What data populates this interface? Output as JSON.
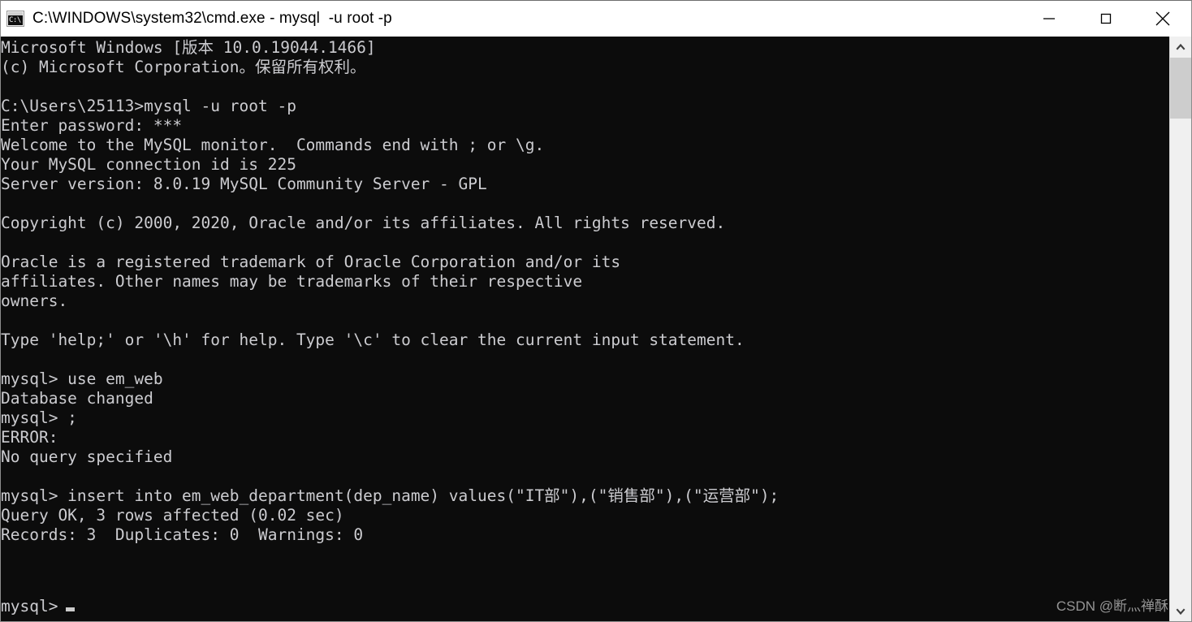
{
  "window": {
    "title": "C:\\WINDOWS\\system32\\cmd.exe - mysql  -u root -p",
    "icon_name": "cmd-console-icon",
    "icon_glyph": "C:\\",
    "background_color": "#0c0c0c",
    "titlebar_color": "#ffffff",
    "text_color": "#ccccd0"
  },
  "controls": {
    "minimize_label": "Minimize",
    "maximize_label": "Maximize",
    "close_label": "Close"
  },
  "terminal": {
    "content": "Microsoft Windows [版本 10.0.19044.1466]\n(c) Microsoft Corporation。保留所有权利。\n\nC:\\Users\\25113>mysql -u root -p\nEnter password: ***\nWelcome to the MySQL monitor.  Commands end with ; or \\g.\nYour MySQL connection id is 225\nServer version: 8.0.19 MySQL Community Server - GPL\n\nCopyright (c) 2000, 2020, Oracle and/or its affiliates. All rights reserved.\n\nOracle is a registered trademark of Oracle Corporation and/or its\naffiliates. Other names may be trademarks of their respective\nowners.\n\nType 'help;' or '\\h' for help. Type '\\c' to clear the current input statement.\n\nmysql> use em_web\nDatabase changed\nmysql> ;\nERROR:\nNo query specified\n\nmysql> insert into em_web_department(dep_name) values(\"IT部\"),(\"销售部\"),(\"运营部\");\nQuery OK, 3 rows affected (0.02 sec)\nRecords: 3  Duplicates: 0  Warnings: 0\n",
    "prompt": "mysql>",
    "lines": [
      "Microsoft Windows [版本 10.0.19044.1466]",
      "(c) Microsoft Corporation。保留所有权利。",
      "",
      "C:\\Users\\25113>mysql -u root -p",
      "Enter password: ***",
      "Welcome to the MySQL monitor.  Commands end with ; or \\g.",
      "Your MySQL connection id is 225",
      "Server version: 8.0.19 MySQL Community Server - GPL",
      "",
      "Copyright (c) 2000, 2020, Oracle and/or its affiliates. All rights reserved.",
      "",
      "Oracle is a registered trademark of Oracle Corporation and/or its",
      "affiliates. Other names may be trademarks of their respective",
      "owners.",
      "",
      "Type 'help;' or '\\h' for help. Type '\\c' to clear the current input statement.",
      "",
      "mysql> use em_web",
      "Database changed",
      "mysql> ;",
      "ERROR:",
      "No query specified",
      "",
      "mysql> insert into em_web_department(dep_name) values(\"IT部\"),(\"销售部\"),(\"运营部\");",
      "Query OK, 3 rows affected (0.02 sec)",
      "Records: 3  Duplicates: 0  Warnings: 0",
      ""
    ],
    "os_version": "10.0.19044.1466",
    "user_path": "C:\\Users\\25113",
    "command": "mysql -u root -p",
    "password_mask": "***",
    "connection_id": "225",
    "server_version": "8.0.19 MySQL Community Server - GPL",
    "database": "em_web",
    "table": "em_web_department",
    "column": "dep_name",
    "inserted_values": [
      "IT部",
      "销售部",
      "运营部"
    ],
    "rows_affected": "3",
    "duration": "0.02 sec",
    "records": "3",
    "duplicates": "0",
    "warnings": "0"
  },
  "watermark": {
    "text": "CSDN @断灬禅酥"
  },
  "scrollbar": {
    "up_arrow_name": "scroll-up-arrow",
    "down_arrow_name": "scroll-down-arrow"
  }
}
